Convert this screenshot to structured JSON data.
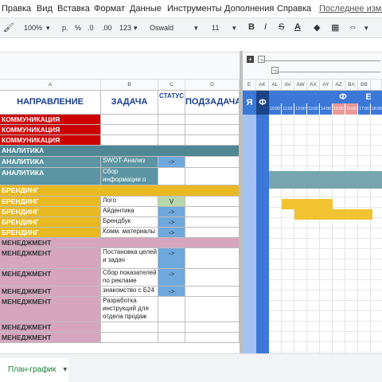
{
  "menu": [
    "Правка",
    "Вид",
    "Вставка",
    "Формат",
    "Данные",
    "Инструменты",
    "Дополнения",
    "Справка"
  ],
  "last_edit": "Последнее измен",
  "toolbar": {
    "zoom": "100%",
    "percent": "%",
    "currency": "р.",
    "dec_minus": ".0",
    "dec_plus": ".00",
    "number_format": "123",
    "font": "Oswald",
    "font_size": "11",
    "bold": "B",
    "italic": "I",
    "strike": "S",
    "text_color": "A"
  },
  "columns": [
    "A",
    "B",
    "C",
    "D",
    "E",
    "AK",
    "AL",
    "AV",
    "AW",
    "AX",
    "AY",
    "AZ",
    "BA",
    "BB"
  ],
  "header": {
    "direction": "НАПРАВЛЕНИЕ",
    "task": "ЗАДАЧА",
    "status": "СТАТУС",
    "subtask": "ПОДЗАДАЧА",
    "e": "Я",
    "f": "Ф"
  },
  "month_letters": [
    "Ф",
    "Е"
  ],
  "time_labels": [
    "10:00",
    "11:02",
    "12:00",
    "13:00",
    "14:00",
    "15:00",
    "16:00",
    "17:00",
    "18:00"
  ],
  "rows": [
    {
      "dir": "КОММУНИКАЦИЯ",
      "task": "",
      "status": "",
      "group": "comm"
    },
    {
      "dir": "КОММУНИКАЦИЯ",
      "task": "",
      "status": "",
      "group": "comm"
    },
    {
      "dir": "КОММУНИКАЦИЯ",
      "task": "",
      "status": "",
      "group": "comm"
    },
    {
      "dir": "АНАЛИТИКА",
      "task": "",
      "status": "",
      "group": "analytics-band"
    },
    {
      "dir": "АНАЛИТИКА",
      "task": "SWOT-Анализ",
      "status": "->",
      "group": "analytics"
    },
    {
      "dir": "АНАЛИТИКА",
      "task": "Сбор информации о компании",
      "status": "",
      "group": "analytics"
    },
    {
      "dir": "БРЕНДИНГ",
      "task": "",
      "status": "",
      "group": "brand-band"
    },
    {
      "dir": "БРЕНДИНГ",
      "task": "Лого",
      "status": "V",
      "group": "brand"
    },
    {
      "dir": "БРЕНДИНГ",
      "task": "Айдентика",
      "status": "->",
      "group": "brand"
    },
    {
      "dir": "БРЕНДИНГ",
      "task": "Брендбук",
      "status": "->",
      "group": "brand"
    },
    {
      "dir": "БРЕНДИНГ",
      "task": "Комм. материалы",
      "status": "->",
      "group": "brand"
    },
    {
      "dir": "МЕНЕДЖМЕНТ",
      "task": "",
      "status": "",
      "group": "mgmt-band"
    },
    {
      "dir": "МЕНЕДЖМЕНТ",
      "task": "Постановка целей и задач",
      "status": "->",
      "group": "mgmt"
    },
    {
      "dir": "МЕНЕДЖМЕНТ",
      "task": "Сбор показателей по рекламе",
      "status": "->",
      "group": "mgmt"
    },
    {
      "dir": "МЕНЕДЖМЕНТ",
      "task": "знакомство с Б24",
      "status": "->",
      "group": "mgmt"
    },
    {
      "dir": "МЕНЕДЖМЕНТ",
      "task": "Разработка инструкций для отдела продаж",
      "status": "",
      "group": "mgmt"
    },
    {
      "dir": "МЕНЕДЖМЕНТ",
      "task": "",
      "status": "",
      "group": "mgmt"
    },
    {
      "dir": "МЕНЕДЖМЕНТ",
      "task": "",
      "status": "",
      "group": "mgmt"
    }
  ],
  "sheet_tab": "План-график",
  "colors": {
    "comm": "#cc0000",
    "analytics_band": "#4f8794",
    "analytics": "#5b95a3",
    "brand": "#e8b923",
    "mgmt_band": "#d5a6bd",
    "mgmt": "#d5a6bd",
    "status_blue": "#6fa8dc",
    "status_green": "#b6d7a8",
    "gantt_blue": "#3c78d8",
    "gantt_teal": "#76a5af",
    "gantt_yellow": "#f1c232",
    "time_pink": "#ea9999"
  }
}
